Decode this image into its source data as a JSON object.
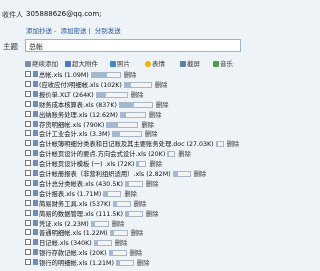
{
  "recipient": {
    "label": "收件人",
    "value": "305888626@qq.com;"
  },
  "links": [
    "添加抄送",
    "添加密送",
    "分别发送"
  ],
  "subject": {
    "label": "主题",
    "value": "总帐"
  },
  "toolbar": [
    "继续添加",
    "超大附件",
    "照片",
    "表情",
    "截屏",
    "音乐"
  ],
  "delete_label": "删除",
  "files": [
    {
      "name": "总帐.xls (1.09M)",
      "progress": 0.55
    },
    {
      "name": "(应收应付)明细帐.xls (102K)",
      "progress": 0.25
    },
    {
      "name": "报价单.XLT (264K)",
      "progress": 0.3
    },
    {
      "name": "财务成本核算表.xls (837K)",
      "progress": 0.45
    },
    {
      "name": "出纳账务处理.xls (12.62M)",
      "progress": 0.2
    },
    {
      "name": "存货明细帐.xls (790K)",
      "progress": 0.35
    },
    {
      "name": "会计工业会计.xls (3.3M)",
      "progress": 0.25
    },
    {
      "name": "会计帐簿明细分类表和日记账及其主要账务处理.doc (27.03K)",
      "progress": 0.1
    },
    {
      "name": "会计帐页设计的要点.方向会式设计.xls (20K)",
      "progress": 0.1
    },
    {
      "name": "会计帐页设计模板 (一) .xls (72K)",
      "progress": 0.15
    },
    {
      "name": "会计帐册报表（非营利组织适用）.xls (2.82M)",
      "progress": 0.25
    },
    {
      "name": "会计总分类帐表.xls (430.5K)",
      "progress": 0.2
    },
    {
      "name": "会计报表.xls (1.71M)",
      "progress": 0.2
    },
    {
      "name": "简易财务工具.xls (537K)",
      "progress": 0.2
    },
    {
      "name": "简易的数据管理.xls (111.5K)",
      "progress": 0.2
    },
    {
      "name": "凭证.xls (2.23M)",
      "progress": 0.2
    },
    {
      "name": "普通明细帐.xls (1.22M)",
      "progress": 0.2
    },
    {
      "name": "日记帐.xls (340K)",
      "progress": 0.2
    },
    {
      "name": "银行存款记帐.xls (20K)",
      "progress": 0.2
    },
    {
      "name": "银行的明细帐.xls (1.21M)",
      "progress": 0.2
    }
  ],
  "colors": {
    "accent": "#1a4f9c",
    "bar_fill": "#9fb8d3",
    "background": "#eef3f8"
  }
}
